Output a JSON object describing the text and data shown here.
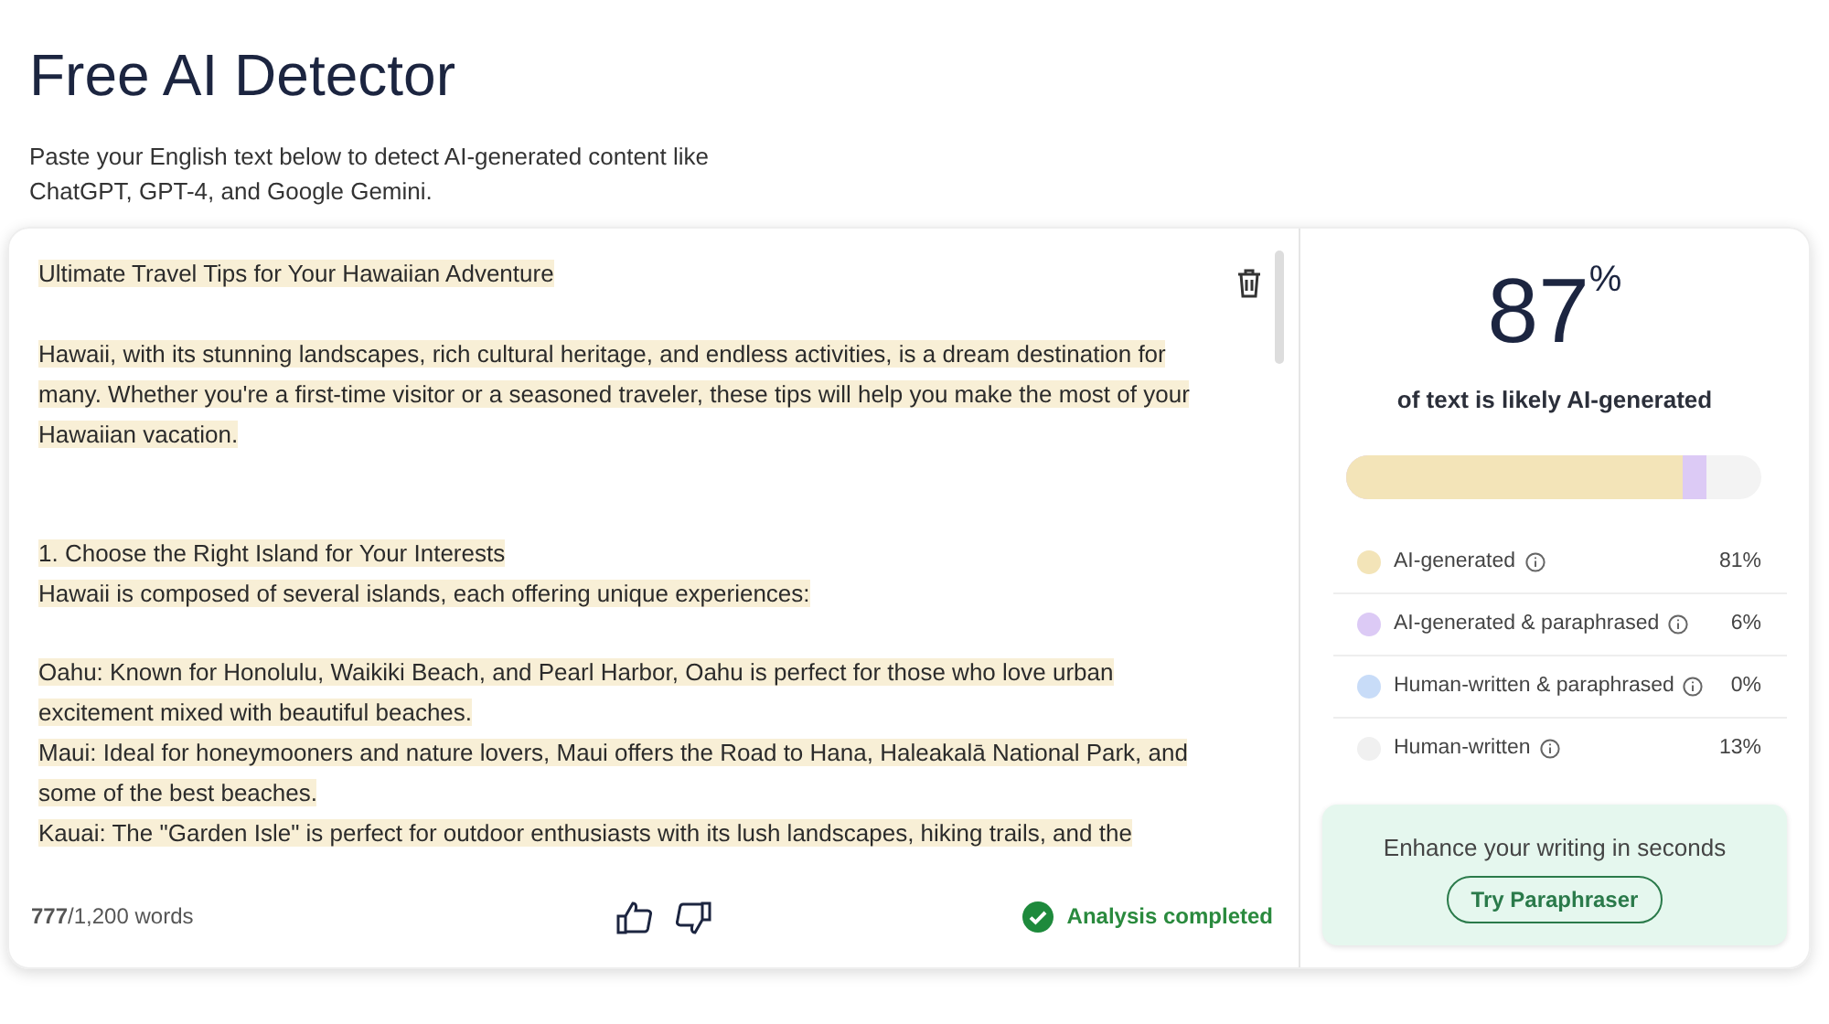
{
  "page": {
    "title": "Free AI Detector",
    "subtitle_lines": [
      "Paste your English text below to detect AI-generated content like",
      "ChatGPT, GPT-4, and Google Gemini."
    ]
  },
  "editor": {
    "groups": [
      {
        "kind": "title",
        "lines": [
          {
            "text": "Ultimate Travel Tips for Your Hawaiian Adventure",
            "highlighted": true
          }
        ]
      },
      {
        "kind": "paragraph",
        "lines": [
          {
            "text": "Hawaii, with its stunning landscapes, rich cultural heritage, and endless activities, is a dream destination for",
            "highlighted": true
          },
          {
            "text": "many. Whether you're a first-time visitor or a seasoned traveler, these tips will help you make the most of your",
            "highlighted": true
          },
          {
            "text": "Hawaiian vacation.",
            "highlighted": true
          }
        ]
      },
      {
        "kind": "section",
        "lines": [
          {
            "text": "1. Choose the Right Island for Your Interests",
            "highlighted": true
          },
          {
            "text": "Hawaii is composed of several islands, each offering unique experiences:",
            "highlighted": true
          }
        ]
      },
      {
        "kind": "paragraph",
        "lines": [
          {
            "text": "Oahu: Known for Honolulu, Waikiki Beach, and Pearl Harbor, Oahu is perfect for those who love urban",
            "highlighted": true
          },
          {
            "text": "excitement mixed with beautiful beaches.",
            "highlighted": true
          },
          {
            "text": "Maui: Ideal for honeymooners and nature lovers, Maui offers the Road to Hana, Haleakalā National Park, and",
            "highlighted": true
          },
          {
            "text": "some of the best beaches.",
            "highlighted": true
          },
          {
            "text": "Kauai: The \"Garden Isle\" is perfect for outdoor enthusiasts with its lush landscapes, hiking trails, and the",
            "highlighted": true
          }
        ]
      }
    ],
    "word_count": "777",
    "word_limit": "/1,200 words",
    "status": "Analysis completed"
  },
  "result": {
    "percent": "87",
    "percent_sign": "%",
    "caption": "of text is likely AI-generated",
    "meter": [
      {
        "level": 0.87,
        "color": "#dccaf5"
      },
      {
        "level": 0.81,
        "color": "#f3e4b8"
      }
    ],
    "categories": [
      {
        "label": "AI-generated",
        "value": "81%",
        "color": "#f3e4b8"
      },
      {
        "label": "AI-generated & paraphrased",
        "value": "6%",
        "color": "#dccaf5"
      },
      {
        "label": "Human-written & paraphrased",
        "value": "0%",
        "color": "#c8dcf8"
      },
      {
        "label": "Human-written",
        "value": "13%",
        "color": "#f0f0f0"
      }
    ],
    "promo": {
      "text": "Enhance your writing in seconds",
      "button": "Try Paraphraser"
    }
  }
}
